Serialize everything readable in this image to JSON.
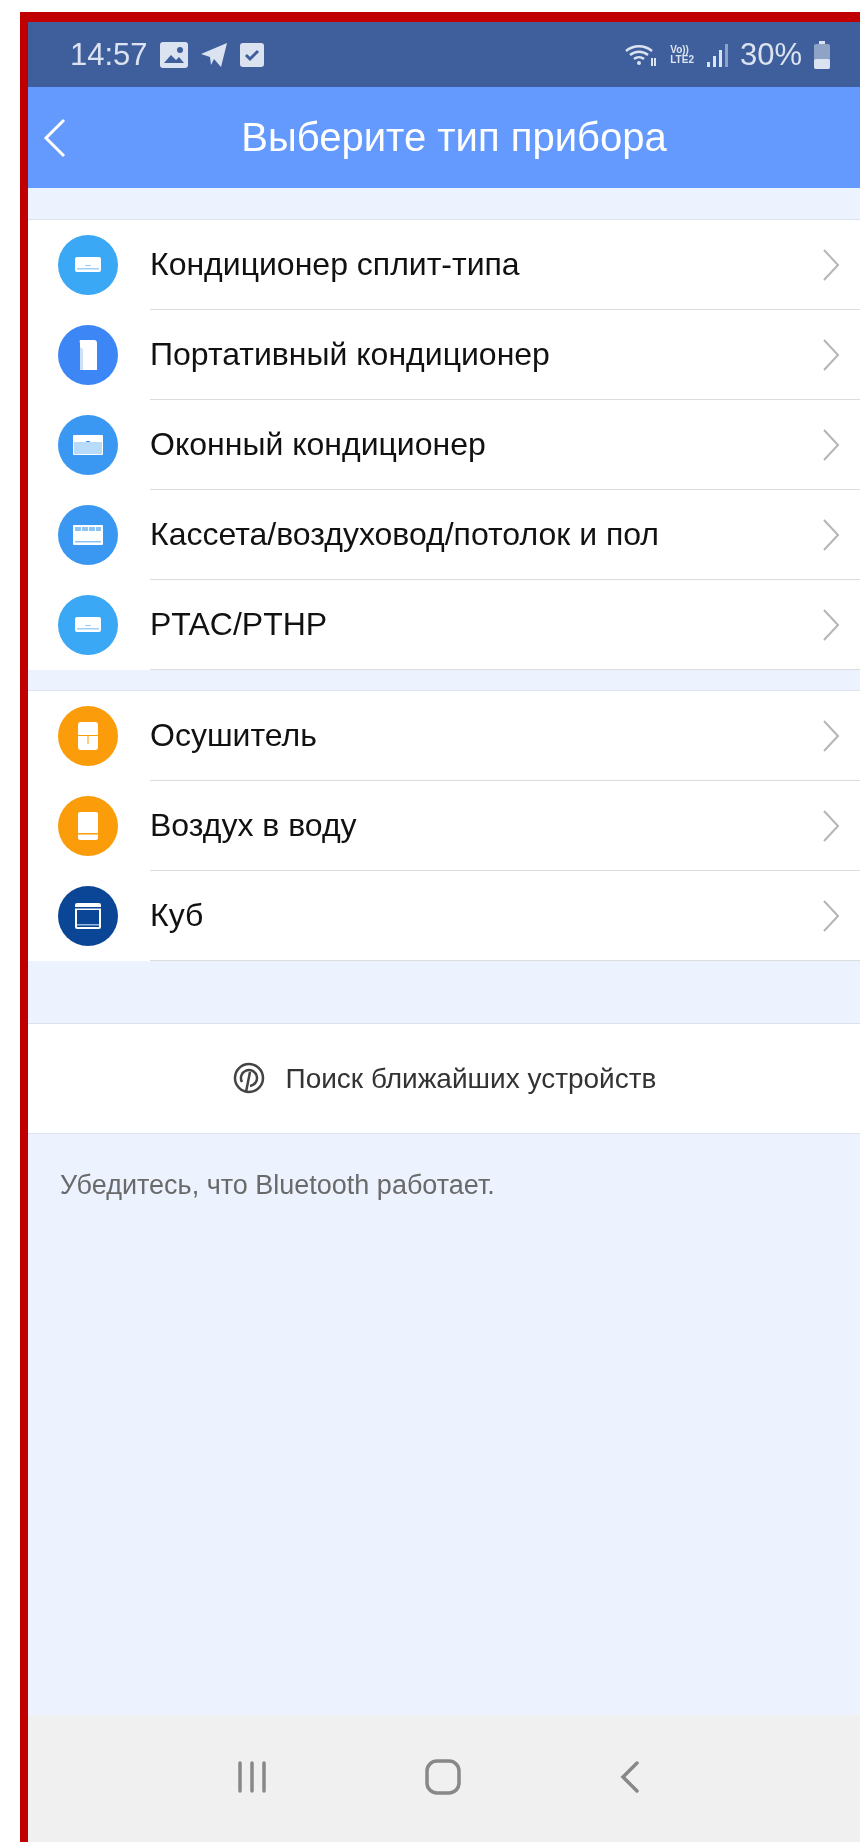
{
  "status_bar": {
    "time": "14:57",
    "network_top": "Vo))",
    "network_bottom": "LTE2",
    "battery": "30%"
  },
  "header": {
    "title": "Выберите тип прибора"
  },
  "groups": [
    {
      "items": [
        {
          "label": "Кондиционер сплит-типа",
          "kind": "split",
          "color": "#3aa8f5"
        },
        {
          "label": "Портативный кондиционер",
          "kind": "portable",
          "color": "#3d86f5"
        },
        {
          "label": "Оконный кондиционер",
          "kind": "window",
          "color": "#3a97f2"
        },
        {
          "label": "Кассета/воздуховод/потолок и пол",
          "kind": "cassette",
          "color": "#3a97f2"
        },
        {
          "label": "PTAC/PTHP",
          "kind": "split",
          "color": "#3aa8f5"
        }
      ]
    },
    {
      "items": [
        {
          "label": "Осушитель",
          "kind": "dehumidifier",
          "color": "#fb9c0b"
        },
        {
          "label": "Воздух в воду",
          "kind": "water",
          "color": "#fb9c0b"
        },
        {
          "label": "Куб",
          "kind": "cube",
          "color": "#0a4596"
        }
      ]
    }
  ],
  "search_button": {
    "label": "Поиск ближайших устройств"
  },
  "note": "Убедитесь, что Bluetooth работает."
}
